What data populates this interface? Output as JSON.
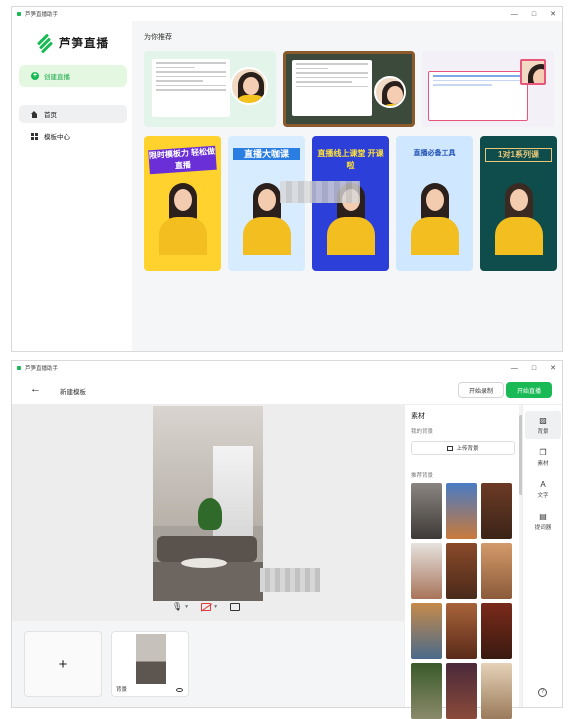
{
  "window1": {
    "app_name": "芦笋直播助手",
    "logo_text": "芦笋直播",
    "create_label": "创建直播",
    "nav": [
      {
        "label": "首页"
      },
      {
        "label": "模板中心"
      }
    ],
    "section_title": "为你推荐",
    "card_titles": [
      "限时模板力 轻松做直播",
      "直播大咖课",
      "直播线上课堂 开课啦",
      "直播必备工具",
      "1对1系列课"
    ]
  },
  "window2": {
    "app_name": "芦笋直播助手",
    "page_name": "新建模板",
    "record_label": "开始录制",
    "live_label": "开始直播",
    "scene_label": "背景",
    "panel": {
      "title": "素材",
      "my_bg": "我的背景",
      "upload_label": "上传背景",
      "recommended": "推荐背景"
    },
    "tabs": [
      {
        "label": "背景",
        "icon": "stripes-icon"
      },
      {
        "label": "素材",
        "icon": "layers-icon"
      },
      {
        "label": "文字",
        "icon": "text-icon"
      },
      {
        "label": "提词器",
        "icon": "prompter-icon"
      }
    ]
  },
  "colors": {
    "accent": "#19b955"
  }
}
